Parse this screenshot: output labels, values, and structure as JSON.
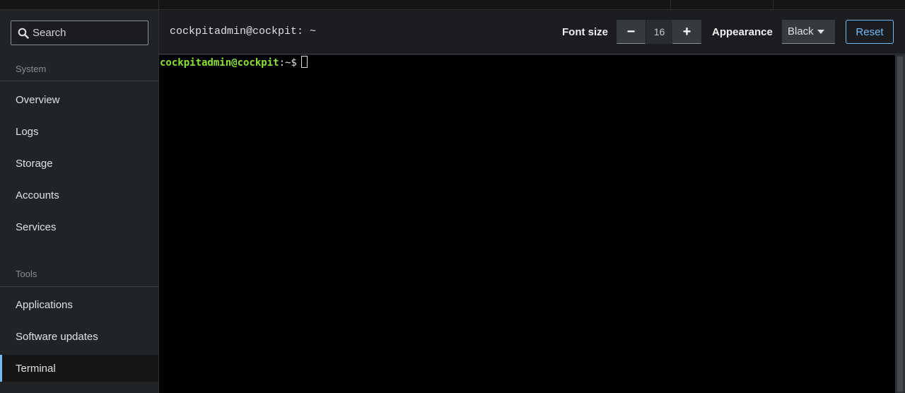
{
  "search": {
    "placeholder": "Search"
  },
  "sidebar": {
    "sections": [
      {
        "label": "System"
      },
      {
        "label": "Tools"
      }
    ],
    "system_items": [
      {
        "label": "Overview"
      },
      {
        "label": "Logs"
      },
      {
        "label": "Storage"
      },
      {
        "label": "Accounts"
      },
      {
        "label": "Services"
      }
    ],
    "tools_items": [
      {
        "label": "Applications"
      },
      {
        "label": "Software updates"
      },
      {
        "label": "Terminal",
        "active": true
      }
    ]
  },
  "toolbar": {
    "title": "cockpitadmin@cockpit: ~",
    "font_size_label": "Font size",
    "font_size_minus": "−",
    "font_size_value": "16",
    "font_size_plus": "+",
    "appearance_label": "Appearance",
    "appearance_value": "Black",
    "reset_label": "Reset"
  },
  "terminal": {
    "prompt_user": "cockpitadmin@cockpit",
    "prompt_suffix": ":~$"
  },
  "colors": {
    "accent": "#73bcf7",
    "prompt_green": "#8ae234",
    "terminal_bg": "#000000",
    "sidebar_bg": "#212427"
  },
  "icons": {
    "search": "search-icon",
    "appearance_caret": "caret-down-icon"
  }
}
